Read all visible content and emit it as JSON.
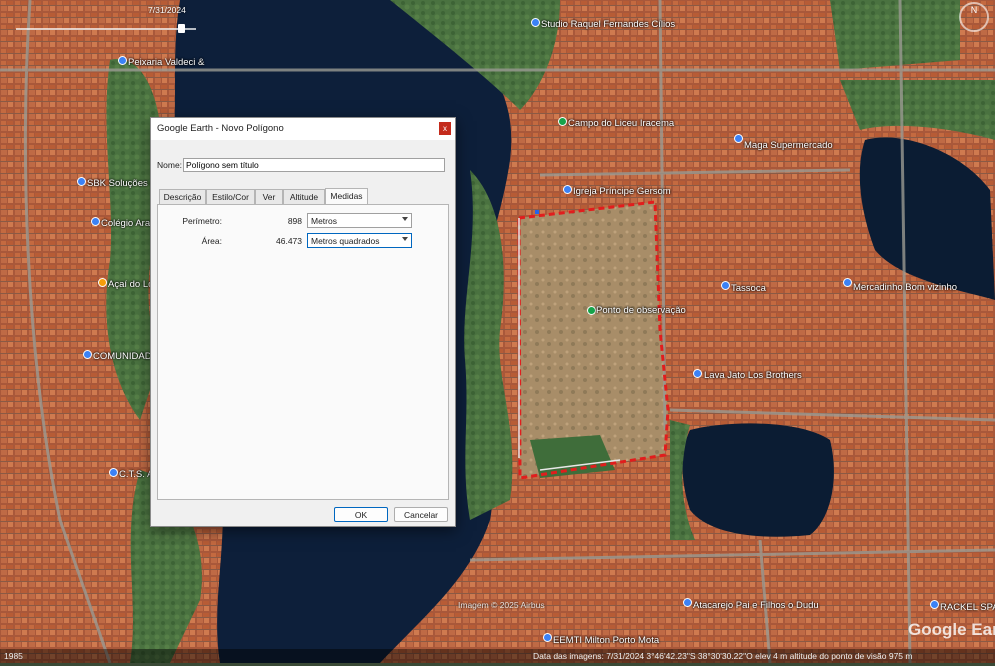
{
  "map": {
    "timeline_date": "7/31/2024",
    "north_label": "N",
    "year": "1985",
    "status_info": "Data das imagens: 7/31/2024     3°46'42.23\"S  38°30'30.22\"O  elev   4 m    altitude do ponto de visão 975 m",
    "copyright": "Imagem © 2025 Airbus",
    "watermark": "Google Earth",
    "labels": [
      {
        "text": "Peixaria Valdeci &",
        "pin": "b"
      },
      {
        "text": "SBK Soluções e",
        "pin": "b"
      },
      {
        "text": "Colégio Araú",
        "pin": "b"
      },
      {
        "text": "Açaí do Lo",
        "pin": "o"
      },
      {
        "text": "COMUNIDAD",
        "pin": "b"
      },
      {
        "text": "C.T.S. A",
        "pin": "b"
      },
      {
        "text": "Studio Raquel Fernandes Cílios",
        "pin": "b"
      },
      {
        "text": "Campo do Liceu Iracema",
        "pin": "g"
      },
      {
        "text": "Maga Supermercado",
        "pin": "b"
      },
      {
        "text": "Igreja Príncipe Gersom",
        "pin": "b"
      },
      {
        "text": "Tassoca",
        "pin": "b"
      },
      {
        "text": "Mercadinho Bom vizinho",
        "pin": "b"
      },
      {
        "text": "Ponto de observação",
        "pin": "g"
      },
      {
        "text": "Lava Jato Los Brothers",
        "pin": "b"
      },
      {
        "text": "Atacarejo Pai e Filhos o Dudu",
        "pin": "b"
      },
      {
        "text": "EEMTI Milton Porto Mota",
        "pin": "b"
      },
      {
        "text": "RACKEL SPA",
        "pin": "b"
      }
    ],
    "colors": {
      "lake": "#0d1f3a",
      "roofs": "#b4552f",
      "vegetation": "#3f6b35",
      "polygon": "#e11d1d"
    }
  },
  "dialog": {
    "title": "Google Earth - Novo Polígono",
    "close_glyph": "x",
    "name_label": "Nome:",
    "name_value": "Polígono sem título",
    "tabs": [
      "Descrição",
      "Estilo/Cor",
      "Ver",
      "Altitude",
      "Medidas"
    ],
    "active_tab": "Medidas",
    "measures": [
      {
        "label": "Perímetro:",
        "value": "898",
        "unit": "Metros"
      },
      {
        "label": "Área:",
        "value": "46.473",
        "unit": "Metros quadrados"
      }
    ],
    "ok_label": "OK",
    "cancel_label": "Cancelar"
  }
}
